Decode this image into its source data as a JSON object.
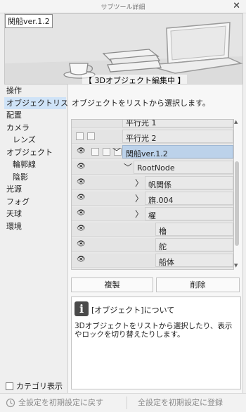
{
  "window": {
    "title": "サブツール詳細",
    "close_glyph": "✕"
  },
  "preview": {
    "object_name": "関船ver.1.2",
    "mode_badge": "【 3Dオブジェクト編集中 】"
  },
  "sidebar": {
    "items": [
      {
        "label": "操作",
        "sub": false
      },
      {
        "label": "オブジェクトリスト",
        "sub": false,
        "selected": true
      },
      {
        "label": "配置",
        "sub": false
      },
      {
        "label": "カメラ",
        "sub": false
      },
      {
        "label": "レンズ",
        "sub": true
      },
      {
        "label": "オブジェクト",
        "sub": false
      },
      {
        "label": "輪郭線",
        "sub": true
      },
      {
        "label": "陰影",
        "sub": true
      },
      {
        "label": "光源",
        "sub": false
      },
      {
        "label": "フォグ",
        "sub": false
      },
      {
        "label": "天球",
        "sub": false
      },
      {
        "label": "環境",
        "sub": false
      }
    ],
    "category_display_label": "カテゴリ表示"
  },
  "main": {
    "description": "オブジェクトをリストから選択します。",
    "object_list": [
      {
        "label": "平行光 1",
        "eye": false,
        "boxes": 0,
        "expander": "none"
      },
      {
        "label": "平行光 2",
        "eye": false,
        "boxes": 2,
        "expander": "none"
      },
      {
        "label": "関船ver.1.2",
        "eye": true,
        "boxes": 3,
        "expander": "open",
        "selected": true
      },
      {
        "label": "RootNode",
        "eye": true,
        "boxes": 0,
        "expander": "open"
      },
      {
        "label": "帆関係",
        "eye": true,
        "boxes": 0,
        "expander": "closed"
      },
      {
        "label": "旗.004",
        "eye": true,
        "boxes": 0,
        "expander": "closed"
      },
      {
        "label": "櫂",
        "eye": true,
        "boxes": 0,
        "expander": "closed"
      },
      {
        "label": "櫓",
        "eye": true,
        "boxes": 0,
        "expander": "none"
      },
      {
        "label": "舵",
        "eye": true,
        "boxes": 0,
        "expander": "none"
      },
      {
        "label": "船体",
        "eye": true,
        "boxes": 0,
        "expander": "none"
      }
    ],
    "duplicate_button": "複製",
    "delete_button": "削除",
    "help": {
      "title": "[オブジェクト]について",
      "body": "3Dオブジェクトをリストから選択したり、表示やロックを切り替えたりします。"
    }
  },
  "footer": {
    "reset_all_label": "全設定を初期設定に戻す",
    "register_all_label": "全設定を初期設定に登録"
  },
  "colors": {
    "selection": "#bcd2ea",
    "sidebar_selection": "#cfe3f7",
    "background": "#efefef"
  }
}
